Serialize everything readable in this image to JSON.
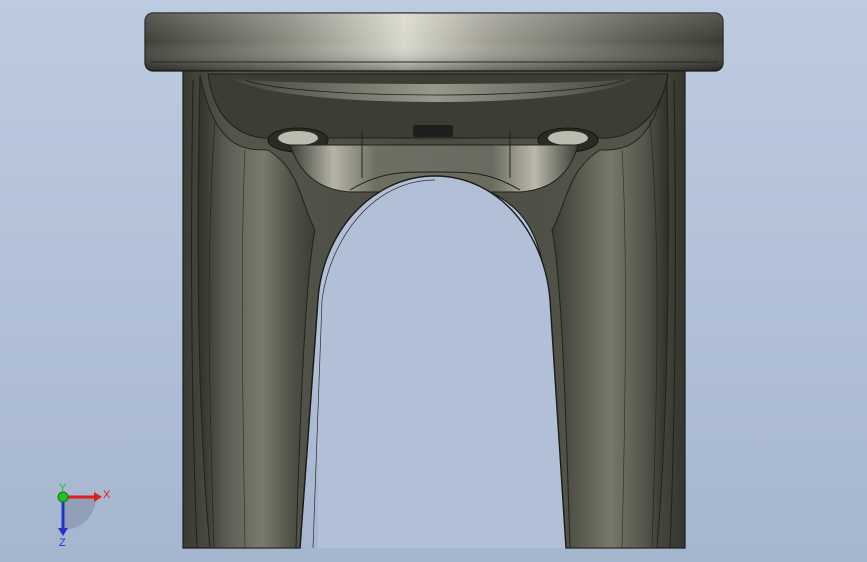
{
  "viewport": {
    "background_top": "#bccbe0",
    "background_bottom": "#a6b6cf",
    "model_color": "#4a4b40"
  },
  "triad": {
    "x_label": "X",
    "y_label": "Y",
    "z_label": "Z",
    "x_color": "#e0201c",
    "y_color": "#1fc21f",
    "z_color": "#2233cc"
  }
}
